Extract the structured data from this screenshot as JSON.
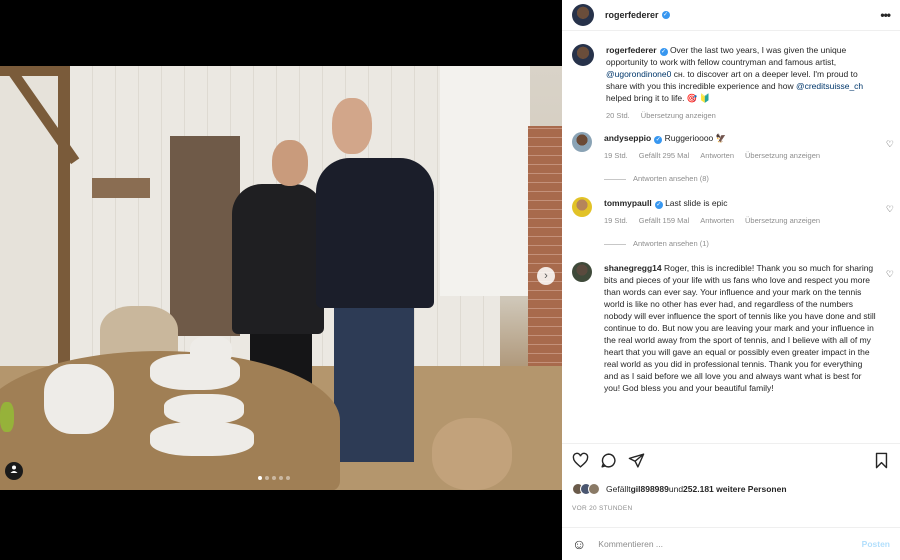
{
  "post": {
    "author": "rogerfederer",
    "verified_mark": "✓",
    "more_icon": "more-horizontal-icon"
  },
  "caption": {
    "username": "rogerfederer",
    "text_1": "Over the last two years, I was given the unique opportunity to work with fellow countryman and famous artist, ",
    "mention_1": "@ugorondinone0",
    "text_2": " сн. to discover art on a deeper level. I'm proud to share with you this incredible experience and how ",
    "mention_2": "@creditsuisse_ch",
    "text_3": " helped bring it to life. 🎯 🔰",
    "time": "20 Std.",
    "translate": "Übersetzung anzeigen"
  },
  "comments": [
    {
      "username": "andyseppio",
      "text": "Ruggerioooo 🦅",
      "time": "19 Std.",
      "likes": "Gefällt 295 Mal",
      "reply": "Antworten",
      "translate": "Übersetzung anzeigen",
      "view_replies": "Antworten ansehen (8)"
    },
    {
      "username": "tommypaull",
      "text": "Last slide is epic",
      "time": "19 Std.",
      "likes": "Gefällt 159 Mal",
      "reply": "Antworten",
      "translate": "Übersetzung anzeigen",
      "view_replies": "Antworten ansehen (1)"
    },
    {
      "username": "shanegregg14",
      "text": "Roger, this is incredible! Thank you so much for sharing bits and pieces of your life with us fans who love and respect you more than words can ever say. Your influence and your mark on the tennis world is like no other has ever had, and regardless of the numbers nobody will ever influence the sport of tennis like you have done and still continue to do. But now you are leaving your mark and your influence in the real world away from the sport of tennis, and I believe with all of my heart that you will gave an equal or possibly even greater impact in the real world as you did in professional tennis. Thank you for everything and as I said before we all love you and always want what is best for you! God bless you and your beautiful family!"
    }
  ],
  "likes": {
    "prefix": "Gefällt ",
    "first_user": "gil898989",
    "middle": " und ",
    "others": "252.181 weitere Personen"
  },
  "time_ago": "VOR 20 STUNDEN",
  "comment_box": {
    "placeholder": "Kommentieren ...",
    "post_label": "Posten"
  },
  "media": {
    "carousel_count": 5,
    "carousel_active": 0,
    "next_arrow": "›"
  },
  "colors": {
    "link": "#00376b",
    "verified": "#3897f0",
    "post_button_disabled": "#b2dffc"
  }
}
